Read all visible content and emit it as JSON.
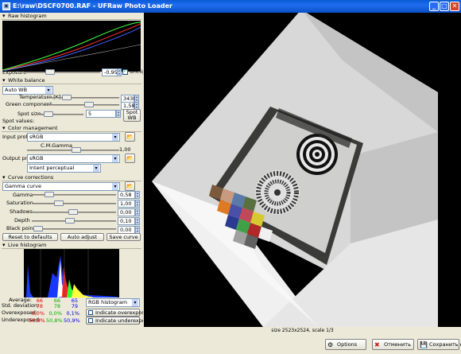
{
  "window": {
    "title": "E:\\raw\\DSCF0700.RAF - UFRaw Photo Loader"
  },
  "raw_histogram": {
    "header": "Raw histogram"
  },
  "exposure": {
    "label": "Exposure",
    "value": "-0,95",
    "unclip_label": "Unclip",
    "unclip_checked": true
  },
  "white_balance": {
    "header": "White balance",
    "preset": "Auto WB",
    "temperature_label": "Temperature [K]",
    "temperature_value": "3430",
    "green_label": "Green component",
    "green_value": "1,58",
    "spot_size_label": "Spot size",
    "spot_size_value": "5",
    "spot_wb_label": "Spot WB",
    "spot_values_label": "Spot values:"
  },
  "color_management": {
    "header": "Color management",
    "input_profile_label": "Input profile",
    "input_profile_value": "sRGB",
    "cm_gamma_label": "C.M.Gamma",
    "cm_gamma_value": "1,00",
    "output_profile_label": "Output profile",
    "output_profile_value": "sRGB",
    "intent_value": "Intent perceptual"
  },
  "curve_corrections": {
    "header": "Curve corrections",
    "curve": "Gamma curve",
    "sliders": [
      {
        "label": "Gamma",
        "value": "0,58"
      },
      {
        "label": "Saturation",
        "value": "1,00"
      },
      {
        "label": "Shadows",
        "value": "0,00"
      },
      {
        "label": "Depth",
        "value": "0,10"
      },
      {
        "label": "Black point",
        "value": "0,00"
      }
    ],
    "reset_label": "Reset to defaults",
    "auto_adjust_label": "Auto adjust",
    "save_curve_label": "Save curve"
  },
  "live_histogram": {
    "header": "Live histogram",
    "average_label": "Average:",
    "average": [
      "66",
      "66",
      "65"
    ],
    "std_label": "Std. deviation:",
    "std": [
      "78",
      "78",
      "79"
    ],
    "overexposed_label": "Overexposed:",
    "overexposed": [
      "0,0%",
      "0,0%",
      "0,1%"
    ],
    "underexposed_label": "Underexposed:",
    "underexposed": [
      "50,9%",
      "50,8%",
      "50,9%"
    ],
    "histogram_mode": "RGB histogram",
    "indicate_over_label": "Indicate overexposure",
    "indicate_under_label": "Indicate underexposure"
  },
  "status": {
    "text": "size 2523x2524, scale 1/3"
  },
  "buttons": {
    "options": "Options",
    "cancel": "Отменить",
    "save_as": "Сохранить как"
  },
  "colors": {
    "titlebar": "#0a5bd6",
    "panel_bg": "#ece9d8",
    "viewer_bg": "#000000",
    "red": "#e00000",
    "green": "#00b000",
    "blue": "#0000e0"
  }
}
